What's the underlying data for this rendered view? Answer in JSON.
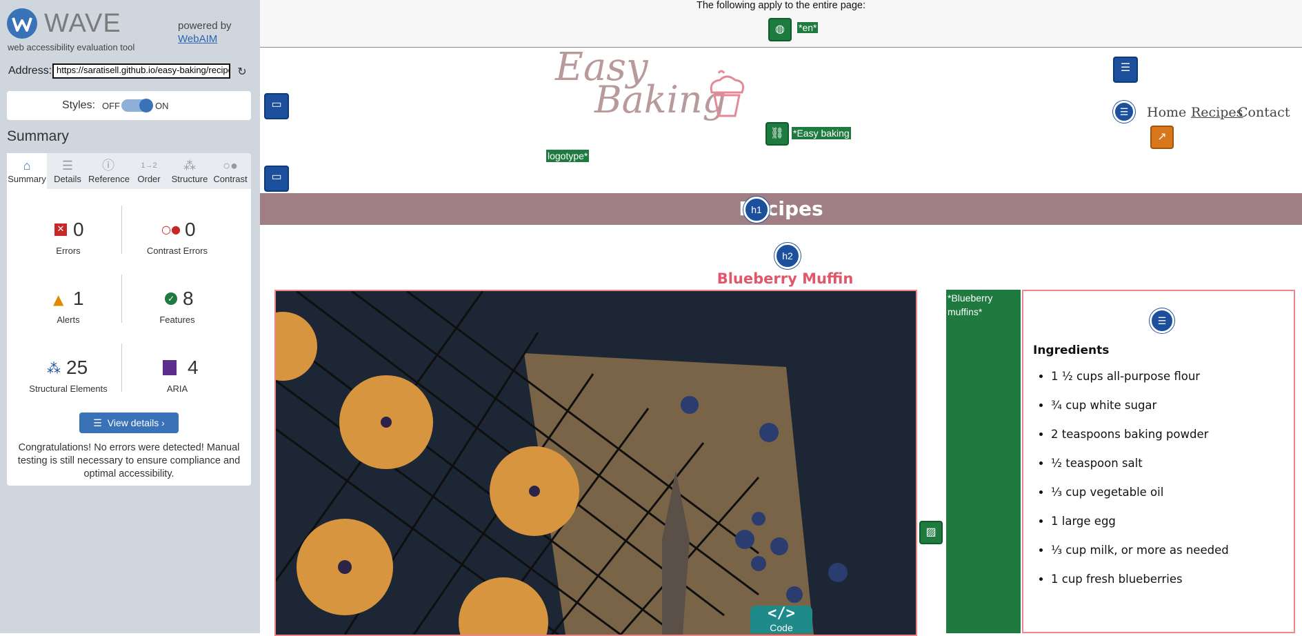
{
  "sidebar": {
    "brand": "WAVE",
    "subtitle": "web accessibility evaluation tool",
    "powered_by": "powered by",
    "powered_link": "WebAIM",
    "address_label": "Address:",
    "address_value": "https://saratisell.github.io/easy-baking/recipes",
    "styles_label": "Styles:",
    "styles_off": "OFF",
    "styles_on": "ON",
    "styles_enabled": true,
    "summary_heading": "Summary",
    "tabs": [
      {
        "label": "Summary",
        "icon": "home-icon"
      },
      {
        "label": "Details",
        "icon": "list-icon"
      },
      {
        "label": "Reference",
        "icon": "info-icon"
      },
      {
        "label": "Order",
        "icon": "order-icon"
      },
      {
        "label": "Structure",
        "icon": "structure-icon"
      },
      {
        "label": "Contrast",
        "icon": "contrast-icon"
      }
    ],
    "stats": {
      "errors": {
        "count": "0",
        "label": "Errors"
      },
      "contrast_errors": {
        "count": "0",
        "label": "Contrast Errors"
      },
      "alerts": {
        "count": "1",
        "label": "Alerts"
      },
      "features": {
        "count": "8",
        "label": "Features"
      },
      "structural": {
        "count": "25",
        "label": "Structural Elements"
      },
      "aria": {
        "count": "4",
        "label": "ARIA"
      }
    },
    "view_details": "View details ›",
    "congrats": "Congratulations! No errors were detected! Manual testing is still necessary to ensure compliance and optimal accessibility."
  },
  "page": {
    "notice": "The following apply to the entire page:",
    "lang_label": "*en*",
    "logo_line1": "Easy",
    "logo_line2": "Baking",
    "logo_alt": "*Easy baking",
    "logo_alt_2": "logotype*",
    "nav": [
      {
        "label": "Home"
      },
      {
        "label": "Recipes"
      },
      {
        "label": "Contact"
      }
    ],
    "h1": "Recipes",
    "h1_badge": "h1",
    "h2_badge": "h2",
    "h2": "Blueberry Muffin",
    "image_alt": "*Blueberry muffins*",
    "ingredients_title": "Ingredients",
    "ingredients": [
      "1 ½ cups all-purpose flour",
      "¾ cup white sugar",
      "2 teaspoons baking powder",
      "½ teaspoon salt",
      "⅓ cup vegetable oil",
      "1 large egg",
      "⅓ cup milk, or more as needed",
      "1 cup fresh blueberries"
    ],
    "code_button": "Code",
    "code_icon": "</>"
  },
  "colors": {
    "wave_blue": "#3a72b8",
    "feature_green": "#1e7a3e",
    "structure_blue": "#1c4f9c",
    "h1_bar": "#9f7f84",
    "h2_color": "#e0566a",
    "error_red": "#c62828",
    "alert_orange": "#e08a00"
  }
}
